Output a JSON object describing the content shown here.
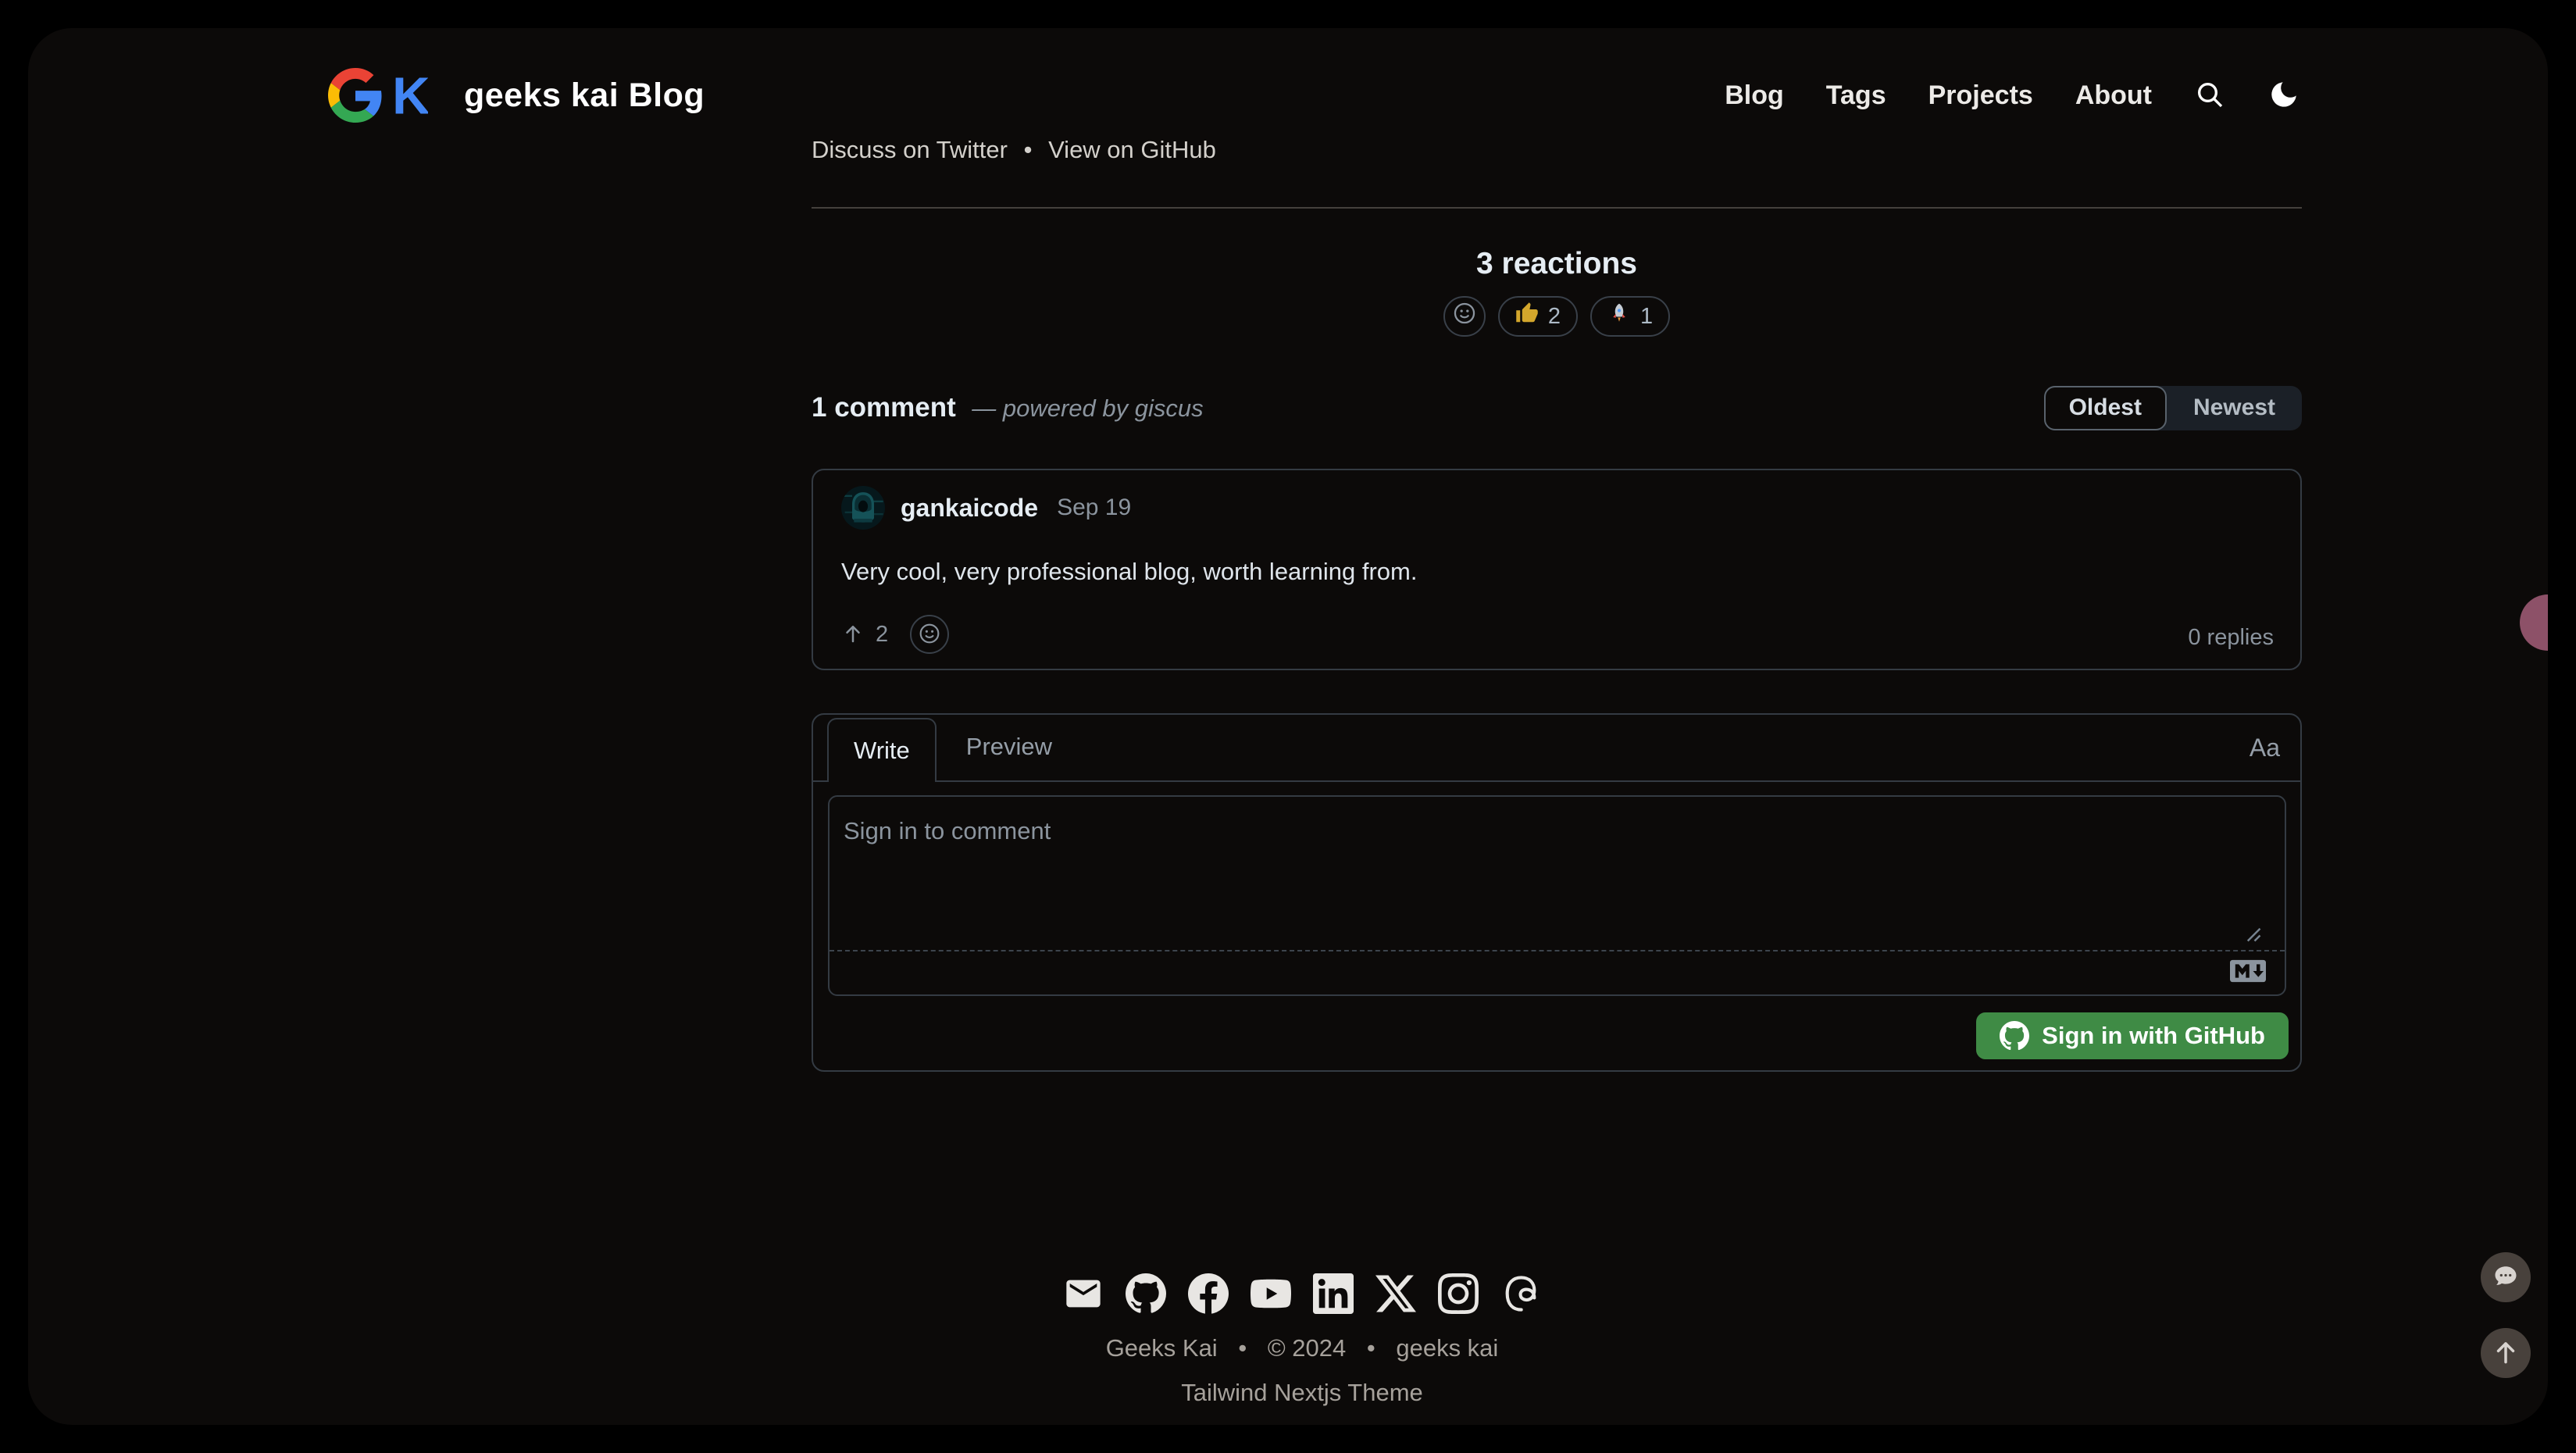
{
  "header": {
    "title": "geeks kai Blog",
    "nav": [
      {
        "label": "Blog"
      },
      {
        "label": "Tags"
      },
      {
        "label": "Projects"
      },
      {
        "label": "About"
      }
    ]
  },
  "share": {
    "discuss": "Discuss on Twitter",
    "sep": "•",
    "view": "View on GitHub"
  },
  "reactions": {
    "title": "3 reactions",
    "items": [
      {
        "name": "thumbs-up",
        "count": "2"
      },
      {
        "name": "rocket",
        "count": "1"
      }
    ]
  },
  "comments": {
    "count_label": "1 comment",
    "powered_by": "— powered by giscus",
    "sort": {
      "oldest": "Oldest",
      "newest": "Newest"
    },
    "comment": {
      "author": "gankaicode",
      "date": "Sep 19",
      "body": "Very cool, very professional blog, worth learning from.",
      "upvotes": "2",
      "replies": "0 replies"
    },
    "editor": {
      "write_tab": "Write",
      "preview_tab": "Preview",
      "format_label": "Aa",
      "placeholder": "Sign in to comment",
      "signin_label": "Sign in with GitHub"
    }
  },
  "footer": {
    "line1": [
      "Geeks Kai",
      "© 2024",
      "geeks kai"
    ],
    "sep": "•",
    "theme": "Tailwind Nextjs Theme",
    "social": [
      "mail",
      "github",
      "facebook",
      "youtube",
      "linkedin",
      "x",
      "instagram",
      "threads"
    ]
  },
  "colors": {
    "signin_green": "#3f8b45",
    "pink_bubble": "#8d5168",
    "page_bg": "#0c0a09"
  }
}
